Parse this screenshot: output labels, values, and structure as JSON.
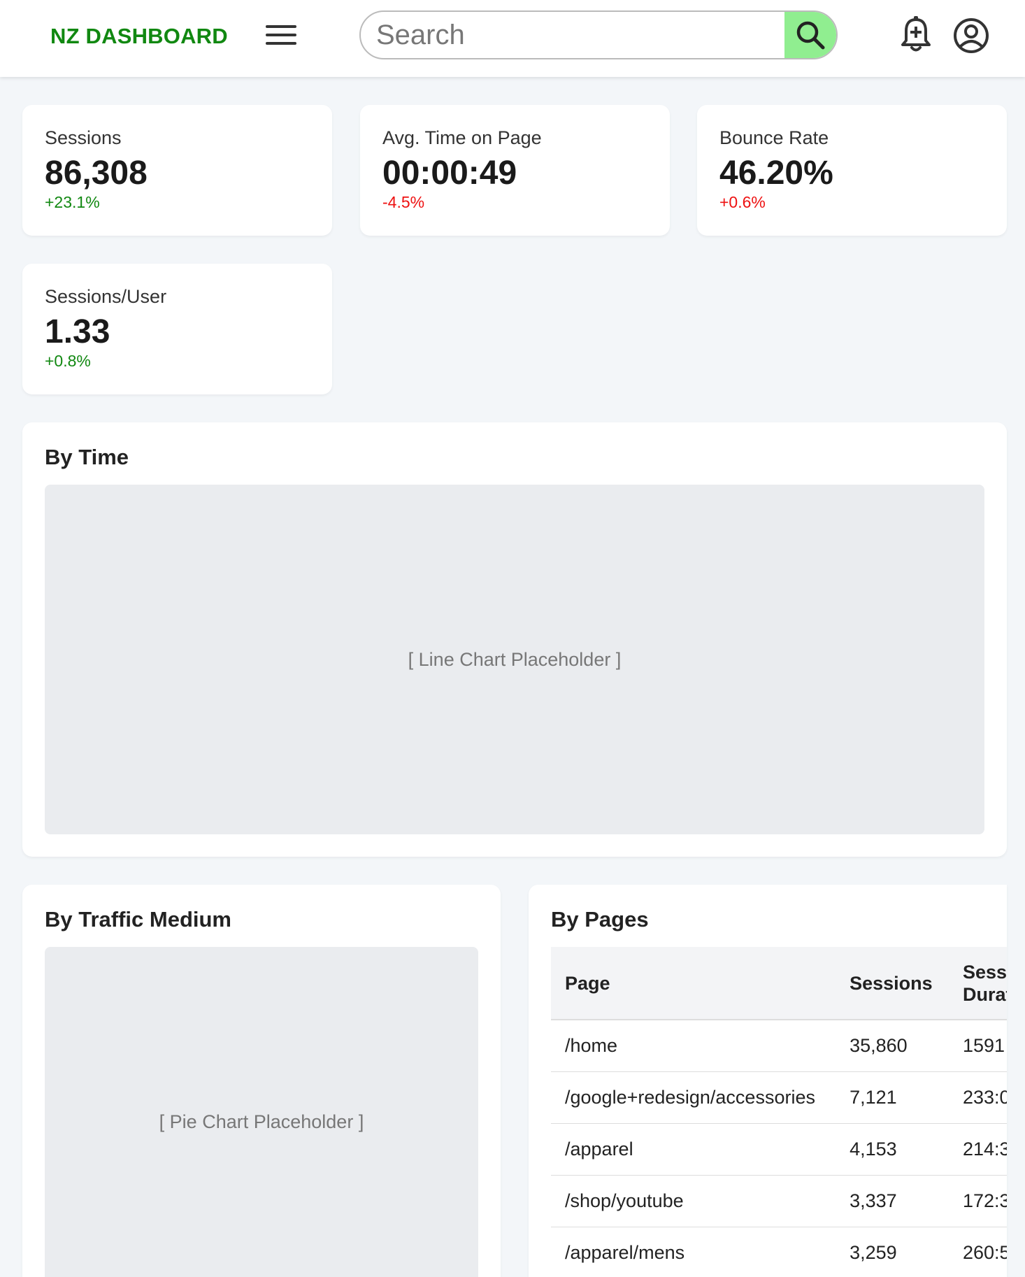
{
  "header": {
    "brand": "NZ DASHBOARD",
    "search_placeholder": "Search",
    "icons": [
      "menu-icon",
      "search-icon",
      "bell-plus-icon",
      "user-circle-icon"
    ],
    "accent_color": "#118811",
    "search_button_color": "#90ee90"
  },
  "metrics": [
    {
      "label": "Sessions",
      "value": "86,308",
      "change": "+23.1%",
      "change_color": "#118811"
    },
    {
      "label": "Avg. Time on Page",
      "value": "00:00:49",
      "change": "-4.5%",
      "change_color": "#ee1111"
    },
    {
      "label": "Bounce Rate",
      "value": "46.20%",
      "change": "+0.6%",
      "change_color": "#ee1111"
    },
    {
      "label": "Sessions/User",
      "value": "1.33",
      "change": "+0.8%",
      "change_color": "#118811"
    }
  ],
  "by_time": {
    "title": "By Time",
    "placeholder": "[ Line Chart Placeholder ]"
  },
  "by_traffic": {
    "title": "By Traffic Medium",
    "placeholder": "[ Pie Chart Placeholder ]"
  },
  "by_pages": {
    "title": "By Pages",
    "columns": [
      "Page",
      "Sessions",
      "Session Duration"
    ],
    "rows": [
      {
        "page": "/home",
        "sessions": "35,860",
        "duration": "1591"
      },
      {
        "page": "/google+redesign/accessories",
        "sessions": "7,121",
        "duration": "233:0"
      },
      {
        "page": "/apparel",
        "sessions": "4,153",
        "duration": "214:3"
      },
      {
        "page": "/shop/youtube",
        "sessions": "3,337",
        "duration": "172:3"
      },
      {
        "page": "/apparel/mens",
        "sessions": "3,259",
        "duration": "260:5"
      }
    ]
  }
}
